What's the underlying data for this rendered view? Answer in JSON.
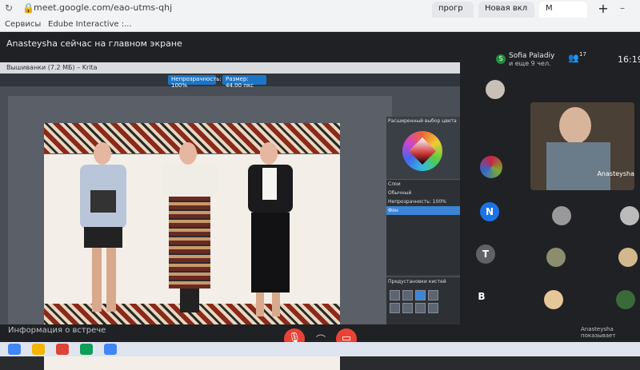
{
  "browser": {
    "tabs": [
      "прогр",
      "Новая вкл",
      "М"
    ],
    "url": "meet.google.com/eao-utms-qhj",
    "bookmarks": [
      "Сервисы",
      "Edube Interactive :..."
    ]
  },
  "meet": {
    "presenting_banner": "Anasteysha сейчас на главном экране",
    "participants_summary": {
      "name": "Sofia Paladiy",
      "more": "и еще 9 чел."
    },
    "participant_count": "17",
    "clock": "16:19",
    "tile_label": "Anasteysha",
    "avatars": [
      {
        "letter": "N",
        "color": "#1a73e8"
      },
      {
        "letter": "T",
        "color": "#1a73e8"
      },
      {
        "letter": "B",
        "color": "#5f6368"
      }
    ],
    "bottom_info": "Информация о встрече",
    "presenter_label": "Anasteysha\nпоказывает"
  },
  "krita": {
    "window_title": "Вышиванки (7.2 МБ) – Krita",
    "field1": "Непрозрачность: 100%",
    "field2": "Размер: 44.00 пкс",
    "docker_title": "Расширенный выбор цвета",
    "layers_title": "Слои",
    "layers_mode": "Обычный",
    "layers_opacity": "Непрозрачность: 100%",
    "layer_name": "Фон",
    "brush_presets": "Предустановки кистей"
  }
}
